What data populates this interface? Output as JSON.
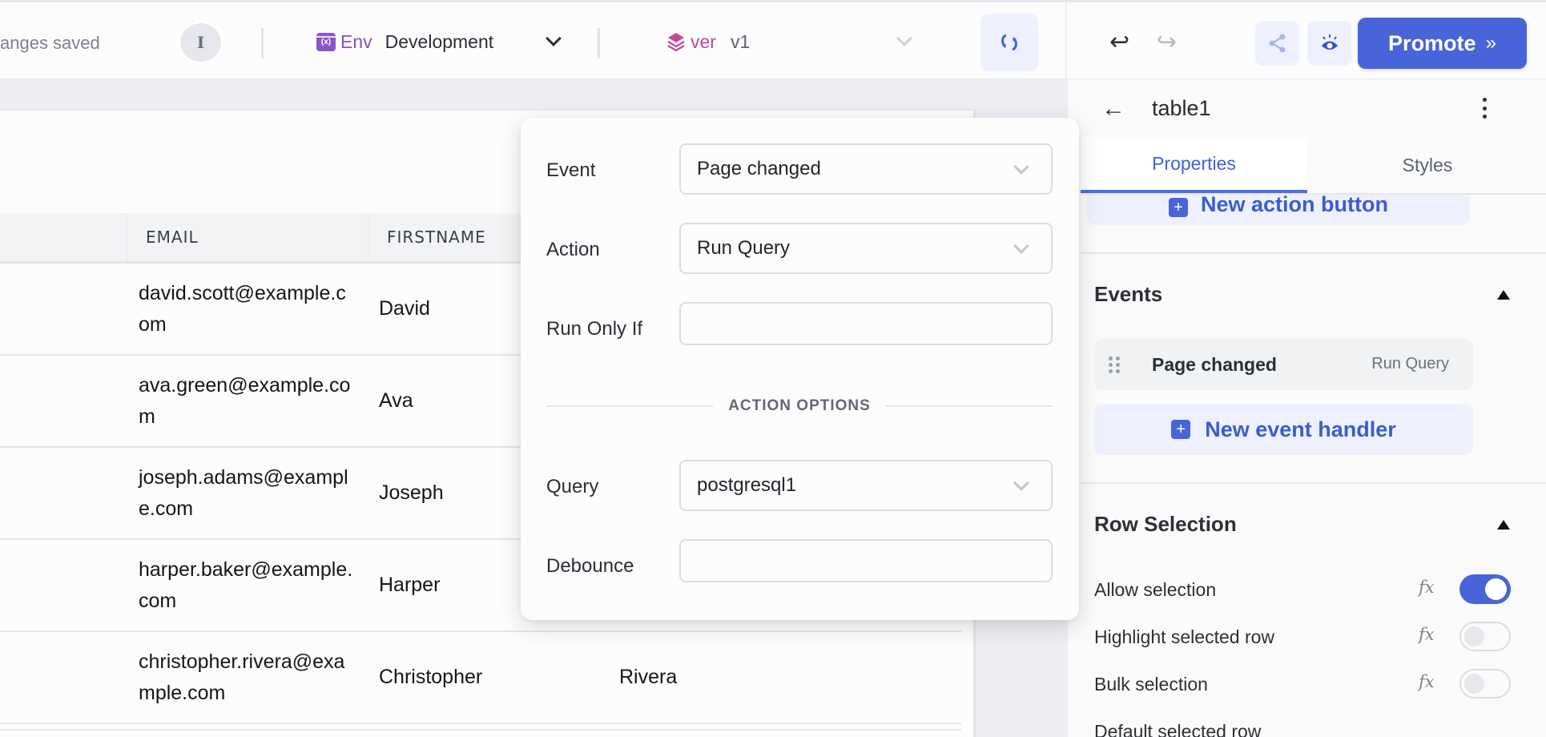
{
  "topbar": {
    "save_status": "anges saved",
    "avatar_initial": "I",
    "env_label": "Env",
    "env_value": "Development",
    "version_label": "ver",
    "version_value": "v1",
    "promote_label": "Promote",
    "icons": {
      "env": "env-variable-icon",
      "version": "layers-icon",
      "sync": "sync-icon",
      "undo": "undo-icon",
      "redo": "redo-icon",
      "share": "share-icon",
      "preview": "eye-icon",
      "promote": "double-chevron-right-icon"
    }
  },
  "table": {
    "columns": [
      "EMAIL",
      "FIRSTNAME"
    ],
    "rows": [
      {
        "email": "david.scott@example.com",
        "firstname": "David",
        "lastname": ""
      },
      {
        "email": "ava.green@example.com",
        "firstname": "Ava",
        "lastname": ""
      },
      {
        "email": "joseph.adams@example.com",
        "firstname": "Joseph",
        "lastname": ""
      },
      {
        "email": "harper.baker@example.com",
        "firstname": "Harper",
        "lastname": ""
      },
      {
        "email": "christopher.rivera@example.com",
        "firstname": "Christopher",
        "lastname": "Rivera"
      }
    ]
  },
  "popover": {
    "event_label": "Event",
    "event_value": "Page changed",
    "action_label": "Action",
    "action_value": "Run Query",
    "run_only_if_label": "Run Only If",
    "run_only_if_value": "",
    "options_heading": "ACTION OPTIONS",
    "query_label": "Query",
    "query_value": "postgresql1",
    "debounce_label": "Debounce",
    "debounce_value": ""
  },
  "panel": {
    "title": "table1",
    "tabs": [
      {
        "label": "Properties",
        "active": true
      },
      {
        "label": "Styles",
        "active": false
      }
    ],
    "new_action_button": "New action button",
    "events": {
      "title": "Events",
      "items": [
        {
          "event": "Page changed",
          "action": "Run Query"
        }
      ],
      "new_handler": "New event handler"
    },
    "row_selection": {
      "title": "Row Selection",
      "fx_label": "fx",
      "props": [
        {
          "label": "Allow selection",
          "enabled": true
        },
        {
          "label": "Highlight selected row",
          "enabled": false
        },
        {
          "label": "Bulk selection",
          "enabled": false
        },
        {
          "label": "Default selected row"
        }
      ]
    }
  },
  "colors": {
    "accent": "#4765d8",
    "env": "#8a4fc7",
    "version": "#c2489b"
  }
}
